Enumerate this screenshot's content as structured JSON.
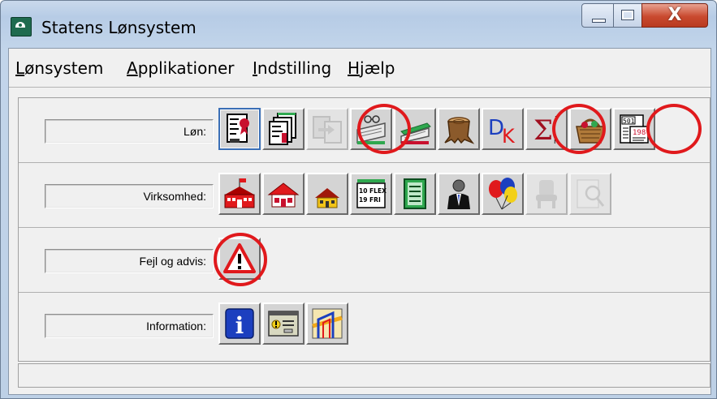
{
  "window": {
    "title": "Statens Lønsystem",
    "close_glyph": "X"
  },
  "menu": [
    {
      "prefix": "",
      "accel": "L",
      "rest": "ønsystem"
    },
    {
      "prefix": "",
      "accel": "A",
      "rest": "pplikationer"
    },
    {
      "prefix": "",
      "accel": "I",
      "rest": "ndstilling"
    },
    {
      "prefix": "",
      "accel": "H",
      "rest": "jælp"
    }
  ],
  "rows": [
    {
      "label": "Løn:",
      "buttons": [
        "document-seal-icon",
        "documents-stack-icon",
        "disabled-transfer-icon",
        "glasses-ledger-icon",
        "green-book-icon",
        "tree-stump-icon",
        "dk-letters-icon",
        "sigma-icon",
        "basket-icon",
        "numbered-report-icon"
      ],
      "highlighted": [
        "glasses-ledger-icon",
        "sigma-icon",
        "numbered-report-icon"
      ]
    },
    {
      "label": "Virksomhed:",
      "buttons": [
        "red-building-flag-icon",
        "red-house-icon",
        "yellow-house-icon",
        "flex-calendar-icon",
        "green-ledger-icon",
        "person-suit-icon",
        "balloons-icon",
        "disabled-chair-icon",
        "disabled-magnifier-icon"
      ],
      "highlighted": []
    },
    {
      "label": "Fejl og advis:",
      "buttons": [
        "warning-triangle-icon"
      ],
      "highlighted": [
        "warning-triangle-icon"
      ]
    },
    {
      "label": "Information:",
      "buttons": [
        "info-icon",
        "message-window-icon",
        "map-route-icon"
      ],
      "highlighted": []
    }
  ],
  "icon_text": {
    "dk_d": "D",
    "dk_k": "K",
    "flex_line1": "10 FLEX",
    "flex_line2": "19 FRI",
    "report_top": "501",
    "report_mid": "198",
    "info_glyph": "i",
    "sigma_glyph": "Σ",
    "sigma_sup": "i",
    "sigma_sub": "n"
  },
  "colors": {
    "highlight_ring": "#e0191c",
    "selected_border": "#3a6fb6"
  }
}
